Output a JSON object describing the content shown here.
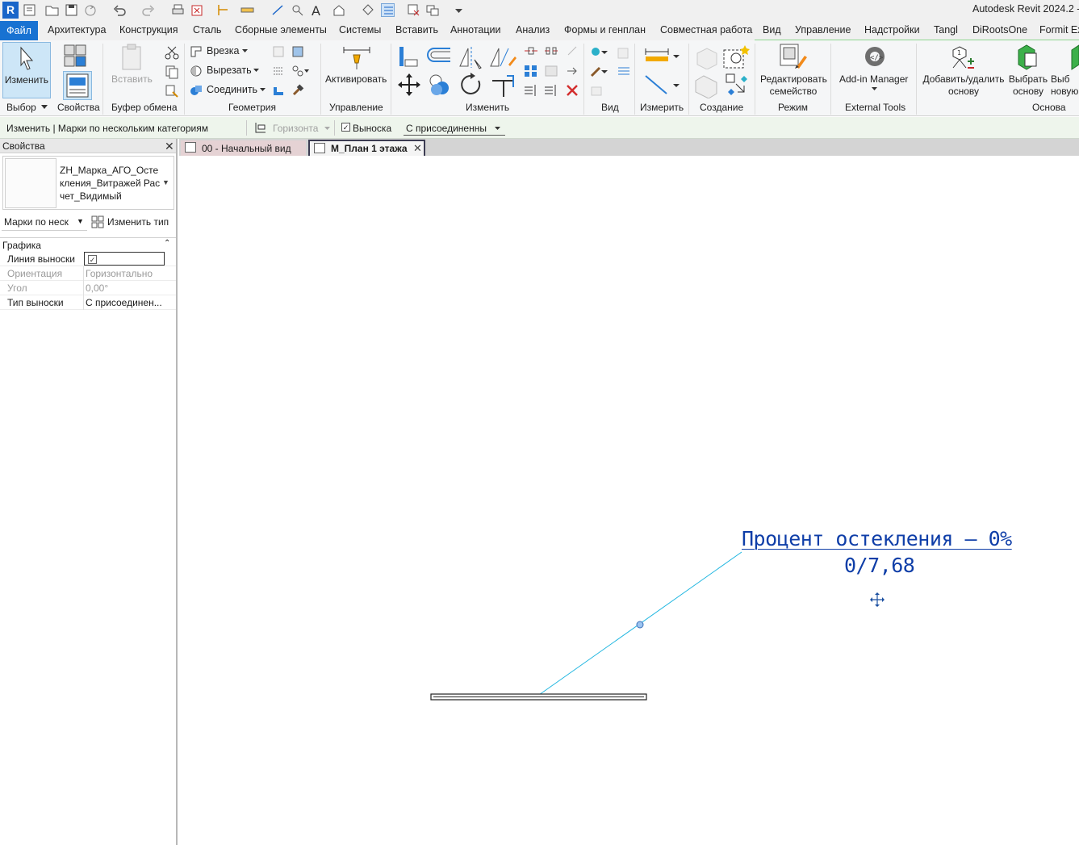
{
  "app": {
    "logo": "R",
    "title": "Autodesk Revit 2024.2 - ["
  },
  "quick_access": {
    "icons": [
      "open-icon",
      "save-icon",
      "sync-icon",
      "undo-icon",
      "redo-icon",
      "print-icon",
      "close-view-icon",
      "align-dim-icon",
      "measure-icon",
      "tag-icon",
      "text-icon",
      "home-3d-icon",
      "section-icon",
      "thin-lines-icon",
      "close-hidden-icon",
      "switch-windows-icon",
      "customize-icon"
    ]
  },
  "ribbon_tabs": [
    "Файл",
    "Архитектура",
    "Конструкция",
    "Сталь",
    "Сборные элементы",
    "Системы",
    "Вставить",
    "Аннотации",
    "Анализ",
    "Формы и генплан",
    "Совместная работа",
    "Вид",
    "Управление",
    "Надстройки",
    "Tangl",
    "DiRootsOne",
    "Formit Ex"
  ],
  "ribbon": {
    "modify_label": "Изменить",
    "paste_label": "Вставить",
    "cope_label": "Врезка",
    "cut_label": "Вырезать",
    "join_label": "Соединить",
    "activate_label": "Активировать",
    "edit_family_label": "Редактировать семейство",
    "addin_manager_label": "Add-in Manager",
    "add_remove_host_label": "Добавить/удалить основу",
    "pick_host_label": "Выбрать основу",
    "pick_new_label": "Выб новую",
    "panels": {
      "select": "Выбор",
      "properties": "Свойства",
      "clipboard": "Буфер обмена",
      "geometry": "Геометрия",
      "control": "Управление",
      "modify": "Изменить",
      "view": "Вид",
      "measure": "Измерить",
      "create": "Создание",
      "mode": "Режим",
      "external_tools": "External Tools",
      "host": "Основа"
    }
  },
  "options_bar": {
    "context": "Изменить | Марки по нескольким категориям",
    "orientation": "Горизонта",
    "leader_label": "Выноска",
    "leader_checked": true,
    "attachment": "С присоединенны"
  },
  "properties": {
    "title": "Свойства",
    "type_name": "ZH_Марка_АГО_Остекления_Витражей Расчет_Видимый",
    "filter": "Марки по неск",
    "edit_type": "Изменить тип",
    "group": "Графика",
    "rows": [
      {
        "key": "Линия выноски",
        "value": "",
        "checkbox": true
      },
      {
        "key": "Ориентация",
        "value": "Горизонтально"
      },
      {
        "key": "Угол",
        "value": "0,00°"
      },
      {
        "key": "Тип выноски",
        "value": "С присоединен..."
      }
    ]
  },
  "view_tabs": [
    {
      "label": "00 - Начальный вид",
      "active": false
    },
    {
      "label": "М_План 1 этажа",
      "active": true
    }
  ],
  "canvas": {
    "tag_line1": "Процент остекления – 0%",
    "tag_line2": "0/7,68",
    "tag_color": "#0f3ea8",
    "leader_color": "#1fb6e0"
  }
}
